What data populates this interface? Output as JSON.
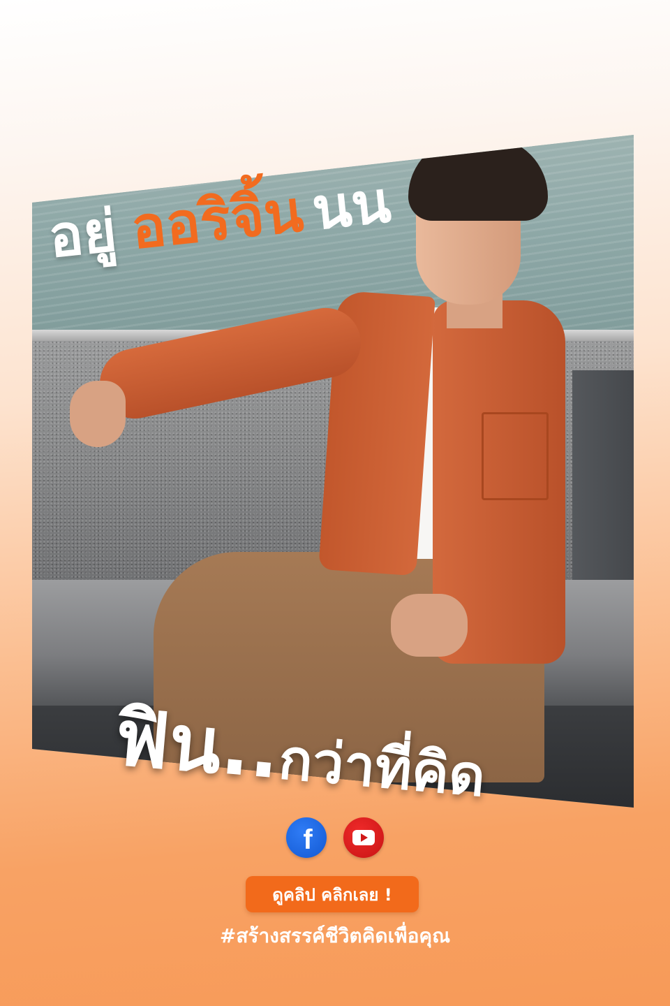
{
  "headline": {
    "top_word_1": "อยู่",
    "top_word_2": "ออริจิ้น",
    "top_word_3": "นน",
    "bottom_big": "ฟิน..",
    "bottom_small": "กว่าที่คิด"
  },
  "social": {
    "facebook_glyph": "f",
    "facebook_icon": "facebook-icon",
    "youtube_icon": "youtube-icon"
  },
  "cta": {
    "label": "ดูคลิป คลิกเลย !"
  },
  "hashtag": "#สร้างสรรค์ชีวิตคิดเพื่อคุณ",
  "colors": {
    "accent": "#f26a1b",
    "headline_orange": "#f26b1f",
    "facebook": "#1877f2",
    "youtube": "#e62117"
  }
}
